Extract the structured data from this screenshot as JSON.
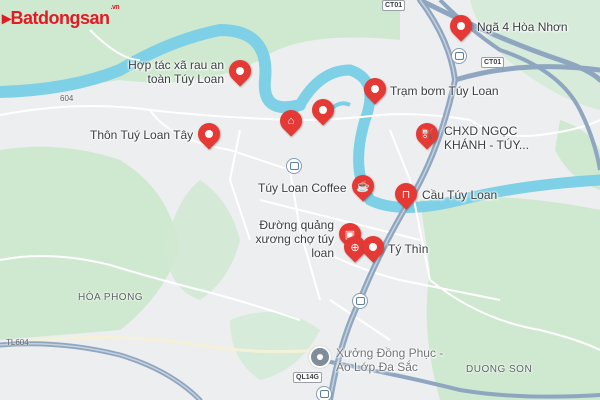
{
  "logo": {
    "text": "Batdongsan",
    "suffix": ".vn"
  },
  "places": {
    "nga4": "Ngã 4 Hòa Nhơn",
    "hoptac": "Hợp tác xã rau an toàn Túy Loan",
    "trambom": "Trạm bơm Túy Loan",
    "thon": "Thôn Tuý Loan Tây",
    "chxd": "CHXD NGỌC KHÁNH - TÚY...",
    "coffee": "Túy Loan Coffee",
    "cau": "Cầu Túy Loan",
    "duong": "Đường quảng xương chợ túy loan",
    "tythin": "Tý Thìn",
    "xuong": "Xưởng Đồng Phục - Áo Lớp Đa Sắc"
  },
  "areas": {
    "hoaphong": "HÒA PHONG",
    "duongson": "DUONG SON"
  },
  "roads": {
    "r604": "604",
    "tl604": "TL604",
    "ql14g": "QL14G",
    "ct01": "CT01",
    "ct01b": "CT01"
  },
  "colors": {
    "pin": "#e53935",
    "river": "#7ed0e6",
    "green": "#cfe9d0",
    "highway": "#8fa6c0"
  },
  "icons": {
    "nga4": "pin-dot-icon",
    "hoptac": "pin-dot-icon",
    "market": "market-icon",
    "pin_center": "pin-dot-icon",
    "trambom": "pin-dot-icon",
    "thon": "pin-dot-icon",
    "chxd": "fuel-icon",
    "coffee": "coffee-icon",
    "cau": "bridge-icon",
    "shop": "shopping-icon",
    "cart": "cart-icon",
    "tythin": "pin-dot-icon"
  }
}
